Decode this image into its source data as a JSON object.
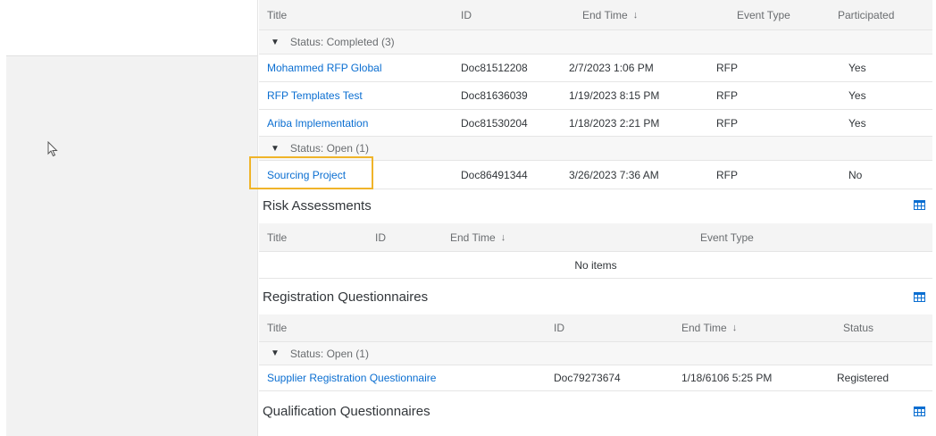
{
  "events_table": {
    "columns": [
      "Title",
      "ID",
      "End Time",
      "Event Type",
      "Participated"
    ],
    "groups": [
      {
        "label": "Status: Completed  (3)",
        "rows": [
          {
            "title": "Mohammed RFP Global",
            "id": "Doc81512208",
            "end_time": "2/7/2023 1:06 PM",
            "event_type": "RFP",
            "participated": "Yes"
          },
          {
            "title": "RFP Templates Test",
            "id": "Doc81636039",
            "end_time": "1/19/2023 8:15 PM",
            "event_type": "RFP",
            "participated": "Yes"
          },
          {
            "title": "Ariba Implementation",
            "id": "Doc81530204",
            "end_time": "1/18/2023 2:21 PM",
            "event_type": "RFP",
            "participated": "Yes"
          }
        ]
      },
      {
        "label": "Status: Open  (1)",
        "rows": [
          {
            "title": "Sourcing Project",
            "id": "Doc86491344",
            "end_time": "3/26/2023 7:36 AM",
            "event_type": "RFP",
            "participated": "No"
          }
        ]
      }
    ]
  },
  "risk_assessments": {
    "title": "Risk Assessments",
    "columns": [
      "Title",
      "ID",
      "End Time",
      "Event Type"
    ],
    "empty_text": "No items"
  },
  "registration_questionnaires": {
    "title": "Registration Questionnaires",
    "columns": [
      "Title",
      "ID",
      "End Time",
      "Status"
    ],
    "group_label": "Status: Open  (1)",
    "rows": [
      {
        "title": "Supplier Registration Questionnaire",
        "id": "Doc79273674",
        "end_time": "1/18/6106 5:25 PM",
        "status": "Registered"
      }
    ]
  },
  "qualification_questionnaires": {
    "title": "Qualification Questionnaires"
  },
  "icons": {
    "sort": "sort-down-arrow-icon",
    "expand": "triangle-down-icon",
    "table_settings": "table-settings-icon",
    "cursor": "mouse-pointer-icon"
  },
  "colors": {
    "link": "#0a6ed1",
    "highlight": "#f0b429",
    "header_bg": "#f4f4f4",
    "table_icon": "#0a6ed1"
  }
}
